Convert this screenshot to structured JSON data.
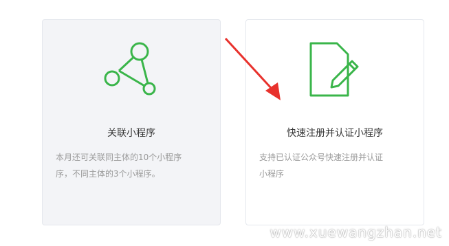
{
  "cards": [
    {
      "title": "关联小程序",
      "desc_line1": "本月还可关联同主体的10个小程序",
      "desc_line2": "序，不同主体的3个小程序。",
      "icon": "network-link-icon"
    },
    {
      "title": "快速注册并认证小程序",
      "desc_line1": "支持已认证公众号快速注册并认证",
      "desc_line2": "小程序",
      "icon": "document-edit-icon"
    }
  ],
  "watermark": "www.xuewangzhan.net",
  "colors": {
    "accent_green": "#3ab54a",
    "annotation_red": "#e8322d"
  }
}
